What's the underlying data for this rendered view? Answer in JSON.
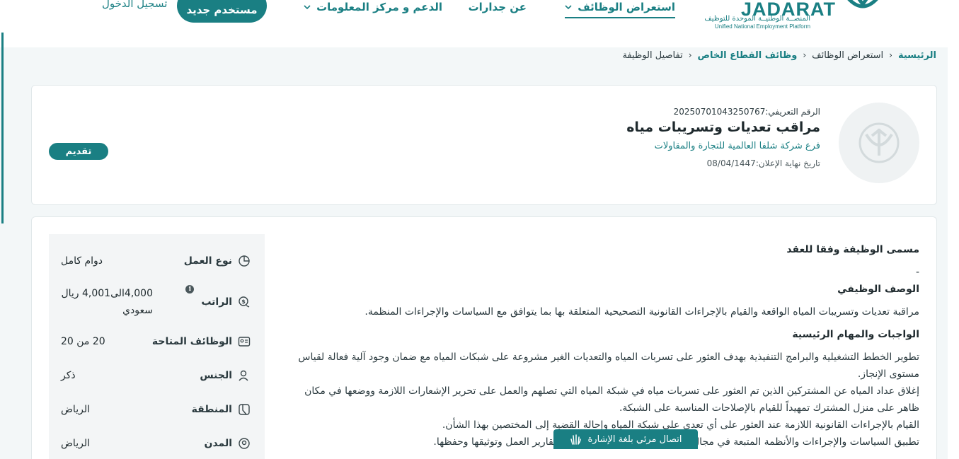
{
  "header": {
    "logo_word": "JADARAT",
    "logo_ar": "المنصــة الوطنيــة الموحدة للتوظيف",
    "logo_en": "Unified National Employment Platform",
    "nav": {
      "browse_jobs": "استعراض الوظائف",
      "about": "عن جدارات",
      "support": "الدعم و مركز المعلومات"
    },
    "new_user_label": "مستخدم جديد",
    "login_label": "تسجيل الدخول"
  },
  "breadcrumb": [
    "الرئيسية",
    "استعراض الوظائف",
    "وظائف القطاع الخاص",
    "تفاصيل الوظيفة"
  ],
  "job": {
    "id_label": "الرقم التعريفي:",
    "id_value": "20250701043250767",
    "title": "مراقب تعديات وتسريبات مياه",
    "company": "فرع شركة شلفا العالمية للتجارة والمقاولات",
    "deadline_label": "تاريخ نهاية الإعلان:",
    "deadline_value": "08/04/1447",
    "apply_label": "تقديم"
  },
  "details": {
    "contract_title_heading": "مسمى الوظيفة وفقا للعقد",
    "contract_title_value": "-",
    "description_heading": "الوصف الوظيفي",
    "description_body": "مراقبة تعديات وتسريبات المياه الواقعة والقيام بالإجراءات القانونية التصحيحية المتعلقة بها بما يتوافق مع السياسات والإجراءات المنظمة.",
    "duties_heading": "الواجبات والمهام الرئيسية",
    "duties": [
      "تطوير الخطط التشغيلية والبرامج التنفيذية بهدف العثور على تسربات المياه والتعديات الغير مشروعة على شبكات المياه مع ضمان وجود آلية فعالة لقياس مستوى الإنجاز.",
      "إغلاق عداد المياه عن المشتركين الذين تم العثور على تسربات مياه في شبكة المياه التي تصلهم والعمل على تحرير الإشعارات اللازمة ووضعها في مكان ظاهر على منزل المشترك تمهيداً للقيام بالإصلاحات المناسبة على الشبكة.",
      "القيام بالإجراءات القانونية اللازمة عند العثور على أي تعدي على شبكة المياه وإحالة القضية إلى المختصين بهذا الشأن.",
      "تطبيق السياسات والإجراءات والأنظمة المتبعة في مجال العمل والالتزام بمعاييرها وتقديم تقارير العمل وتوثيقها وحفظها."
    ]
  },
  "meta": {
    "work_type_label": "نوع العمل",
    "work_type_value": "دوام كامل",
    "salary_label": "الراتب",
    "salary_value": "4,000الى4,001 ريال سعودي",
    "vacancies_label": "الوظائف المتاحة",
    "vacancies_value": "20 من 20",
    "gender_label": "الجنس",
    "gender_value": "ذكر",
    "region_label": "المنطقة",
    "region_value": "الرياض",
    "city_label": "المدن",
    "city_value": "الرياض"
  },
  "sign_language_label": "اتصال مرئي بلغة الإشارة",
  "colors": {
    "brand": "#1a7f83",
    "page_bg": "#f3f7f8"
  }
}
